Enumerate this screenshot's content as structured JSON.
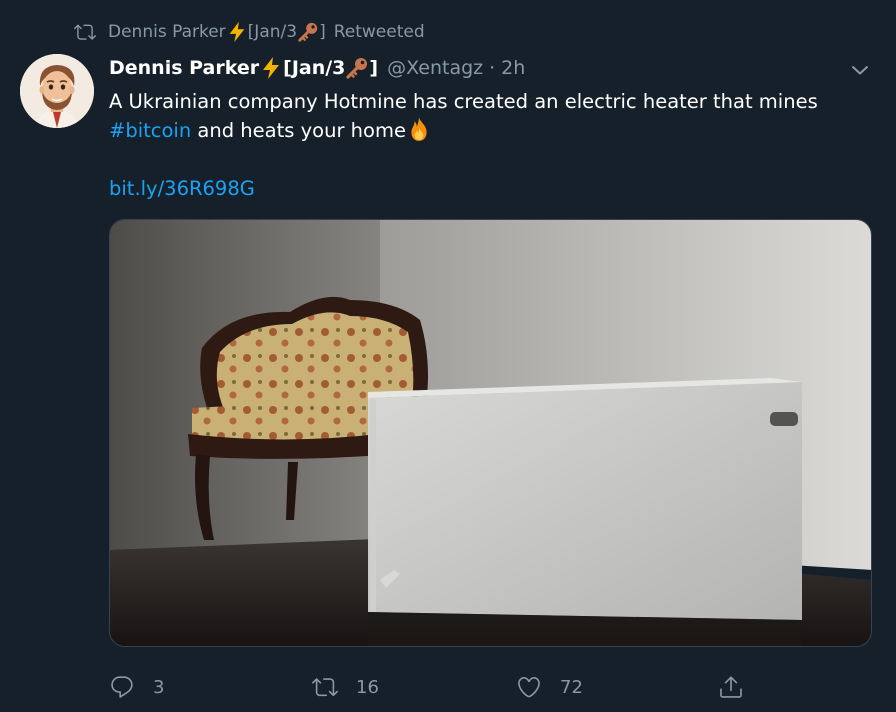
{
  "retweet": {
    "name": "Dennis Parker",
    "tag": "[Jan/3",
    "tag_end": "]",
    "label": "Retweeted"
  },
  "author": {
    "name": "Dennis Parker",
    "tag": "[Jan/3",
    "tag_end": "]",
    "handle": "@Xentagz",
    "separator": "·",
    "time": "2h"
  },
  "tweet": {
    "text_line1": "A Ukrainian company Hotmine has created an electric heater that mines",
    "hashtag": "#bitcoin",
    "text_line2": " and heats your home",
    "link": "bit.ly/36R698G"
  },
  "icons": {
    "retweet": "retweet-icon",
    "lightning": "lightning-emoji",
    "key": "key-emoji",
    "fire": "fire-emoji",
    "caret": "chevron-down-icon",
    "reply": "reply-icon",
    "like": "heart-icon",
    "share": "share-icon"
  },
  "stats": {
    "replies": "3",
    "retweets": "16",
    "likes": "72"
  },
  "colors": {
    "background": "#15202b",
    "secondary_text": "#8899a6",
    "link": "#1da1f2"
  }
}
